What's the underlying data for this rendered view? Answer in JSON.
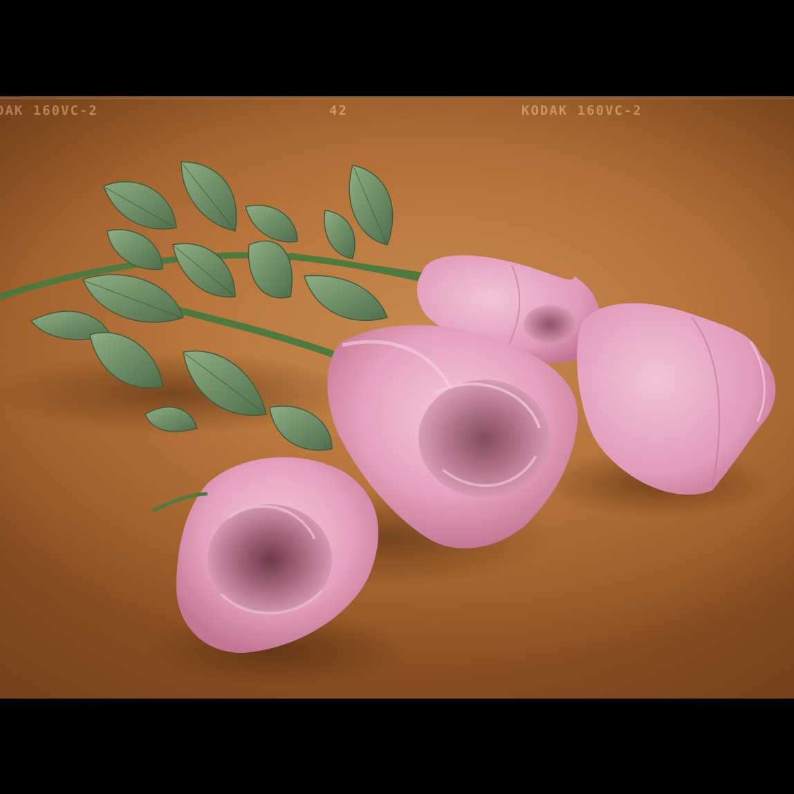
{
  "film_edge": {
    "left_marking": "DAK  160VC-2",
    "frame_number": "42",
    "right_marking": "KODAK  160VC-2"
  },
  "colors": {
    "background": "#b8763c",
    "rose_pink": "#e7a6c3",
    "rose_shadow": "#8a4a5e",
    "leaf_green": "#5e7d58",
    "stem_green": "#4d7a3e"
  }
}
